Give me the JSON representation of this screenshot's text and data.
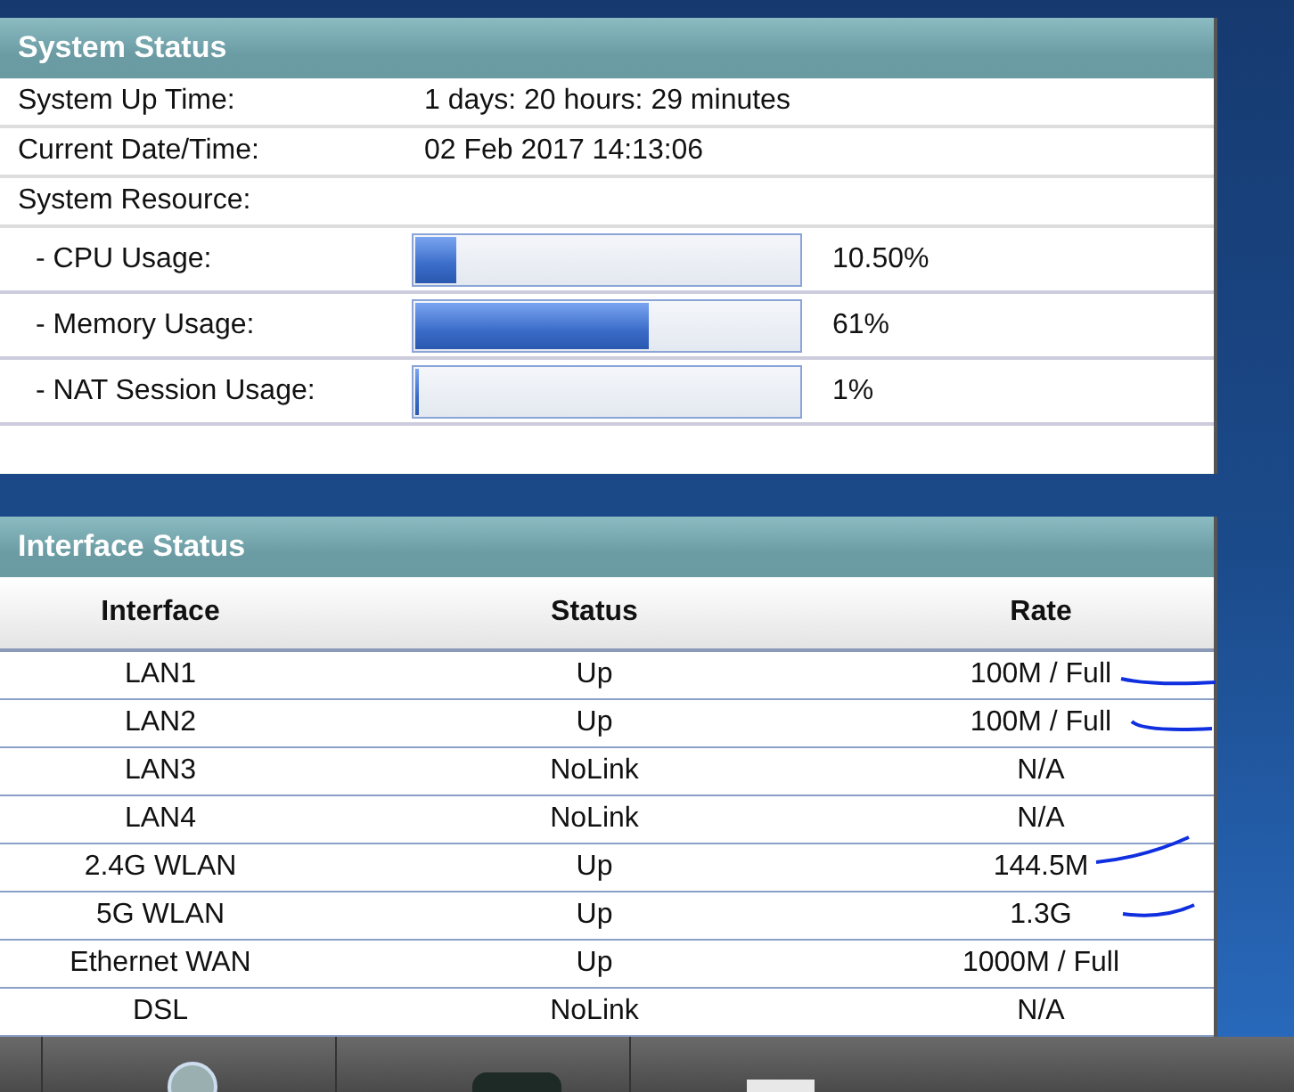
{
  "system_status": {
    "title": "System Status",
    "info": [
      {
        "label": "System Up Time:",
        "value": "1 days: 20 hours: 29 minutes"
      },
      {
        "label": "Current Date/Time:",
        "value": "02 Feb 2017 14:13:06"
      },
      {
        "label": "System Resource:"
      }
    ],
    "resources": [
      {
        "label": "- CPU Usage:",
        "level": 0.105,
        "reading": "10.50%"
      },
      {
        "label": "- Memory Usage:",
        "level": 0.61,
        "reading": "61%"
      },
      {
        "label": "- NAT Session Usage:",
        "level": 0.01,
        "reading": "1%"
      }
    ]
  },
  "interface_status": {
    "title": "Interface Status",
    "columns": [
      "Interface",
      "Status",
      "Rate"
    ],
    "rows": [
      [
        "LAN1",
        "Up",
        "100M / Full"
      ],
      [
        "LAN2",
        "Up",
        "100M / Full"
      ],
      [
        "LAN3",
        "NoLink",
        "N/A"
      ],
      [
        "LAN4",
        "NoLink",
        "N/A"
      ],
      [
        "2.4G WLAN",
        "Up",
        "144.5M"
      ],
      [
        "5G WLAN",
        "Up",
        "1.3G"
      ],
      [
        "Ethernet WAN",
        "Up",
        "1000M / Full"
      ],
      [
        "DSL",
        "NoLink",
        "N/A"
      ]
    ]
  }
}
